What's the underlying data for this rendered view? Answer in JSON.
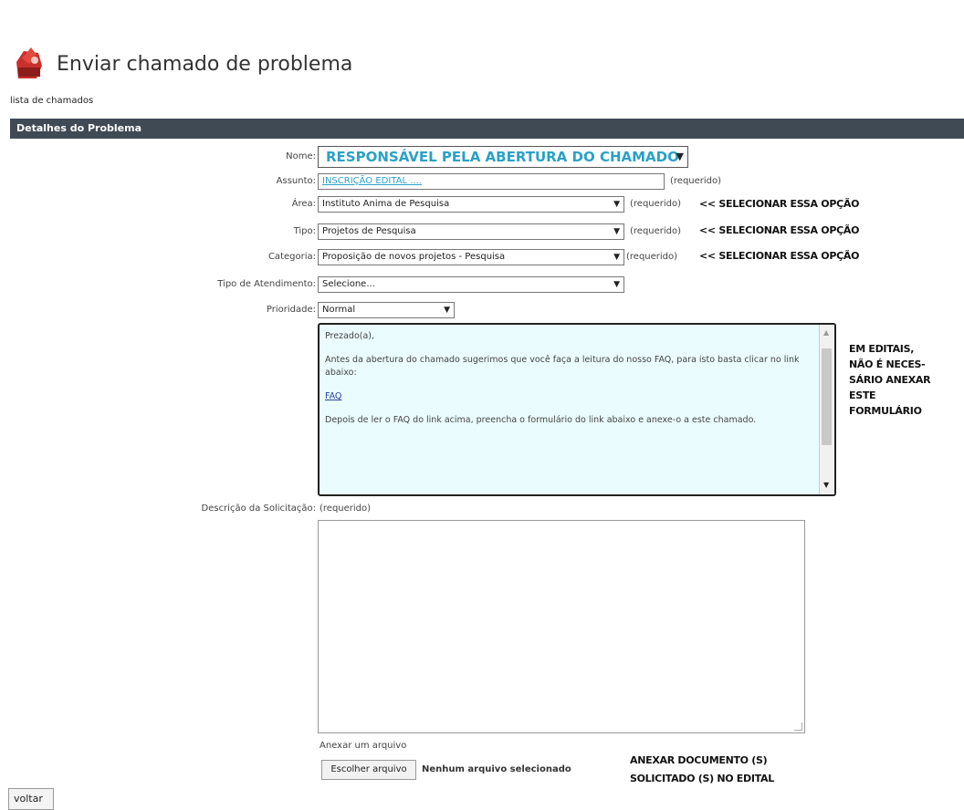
{
  "header": {
    "title": "Enviar chamado de problema",
    "list_link": "lista de chamados",
    "logo_icon": "ticket-icon"
  },
  "section": {
    "title": "Detalhes do Problema"
  },
  "form": {
    "nome": {
      "label": "Nome:",
      "value": "RESPONSÁVEL PELA ABERTURA DO CHAMADO"
    },
    "assunto": {
      "label": "Assunto:",
      "value": "INSCRIÇÃO EDITAL ....",
      "required": "(requerido)"
    },
    "area": {
      "label": "Área:",
      "value": "Instituto Anima de Pesquisa",
      "required": "(requerido)"
    },
    "tipo": {
      "label": "Tipo:",
      "value": "Projetos de Pesquisa",
      "required": "(requerido)"
    },
    "categoria": {
      "label": "Categoria:",
      "value": "Proposição de novos projetos - Pesquisa",
      "required": "(requerido)"
    },
    "tipo_atendimento": {
      "label": "Tipo de Atendimento:",
      "value": "Selecione..."
    },
    "prioridade": {
      "label": "Prioridade:",
      "value": "Normal"
    },
    "descricao": {
      "label": "Descrição da Solicitação:",
      "required": "(requerido)"
    },
    "anexo": {
      "label": "Anexar um arquivo",
      "button": "Escolher arquivo",
      "status": "Nenhum arquivo selecionado"
    }
  },
  "info_box": {
    "greeting": "Prezado(a),",
    "paragraph1": "Antes da abertura do chamado sugerimos que você faça a leitura do nosso FAQ, para isto basta clicar no link abaixo:",
    "faq_link": "FAQ",
    "paragraph2": "Depois de ler o FAQ do link acima, preencha o formulário do link abaixo e anexe-o a este chamado."
  },
  "annotations": {
    "selecionar": "<< SELECIONAR ESSA OPÇÃO",
    "editais_lines": [
      "EM EDITAIS,",
      "NÃO É NECES-",
      "SÁRIO ANEXAR",
      "ESTE",
      "FORMULÁRIO"
    ],
    "anexar_lines": [
      "ANEXAR DOCUMENTO (S)",
      "SOLICITADO (S) NO EDITAL"
    ]
  },
  "footer": {
    "voltar": "voltar"
  },
  "colors": {
    "section_bar": "#3f4a55",
    "highlight_text": "#2aa1c6",
    "info_bg": "#eafcfd"
  }
}
